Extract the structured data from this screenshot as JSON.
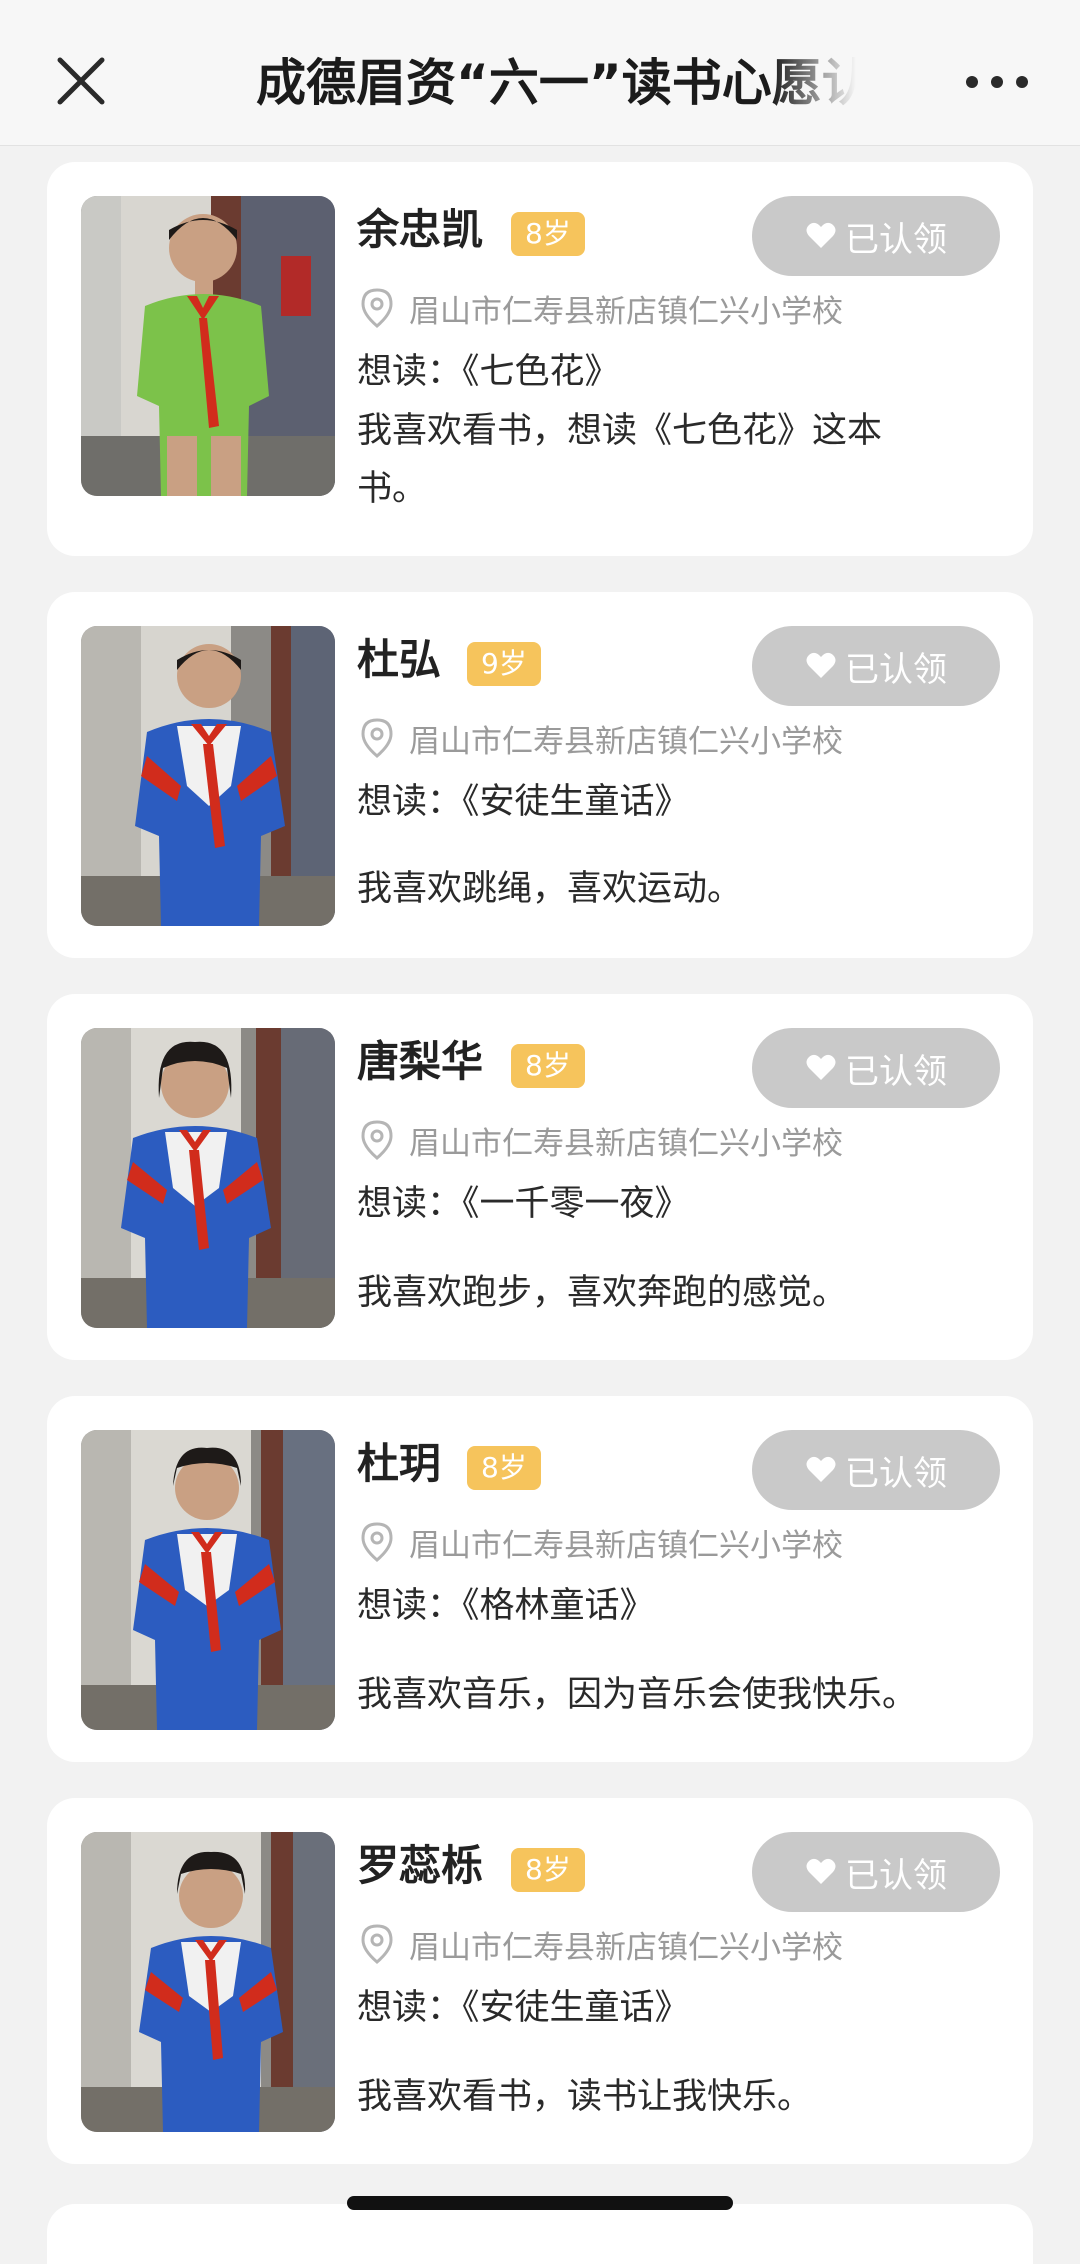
{
  "header": {
    "title": "成德眉资“六一”读书心愿认领",
    "close_icon": "close-icon",
    "more_icon": "more-dots-icon"
  },
  "colors": {
    "age_badge": "#f6c45c",
    "adopted_button": "#c9c9c9",
    "background": "#f2f2f2"
  },
  "children": [
    {
      "name": "余忠凯",
      "age": "8岁",
      "button": "已认领",
      "location": "眉山市仁寿县新店镇仁兴小学校",
      "want": "想读：《七色花》",
      "desc": "我喜欢看书，想读《七色花》这本书。"
    },
    {
      "name": "杜弘",
      "age": "9岁",
      "button": "已认领",
      "location": "眉山市仁寿县新店镇仁兴小学校",
      "want": "想读：《安徒生童话》",
      "desc": "我喜欢跳绳，喜欢运动。"
    },
    {
      "name": "唐梨华",
      "age": "8岁",
      "button": "已认领",
      "location": "眉山市仁寿县新店镇仁兴小学校",
      "want": "想读：《一千零一夜》",
      "desc": "我喜欢跑步，喜欢奔跑的感觉。"
    },
    {
      "name": "杜玥",
      "age": "8岁",
      "button": "已认领",
      "location": "眉山市仁寿县新店镇仁兴小学校",
      "want": "想读：《格林童话》",
      "desc": "我喜欢音乐，因为音乐会使我快乐。"
    },
    {
      "name": "罗蕊栎",
      "age": "8岁",
      "button": "已认领",
      "location": "眉山市仁寿县新店镇仁兴小学校",
      "want": "想读：《安徒生童话》",
      "desc": "我喜欢看书，读书让我快乐。"
    }
  ]
}
